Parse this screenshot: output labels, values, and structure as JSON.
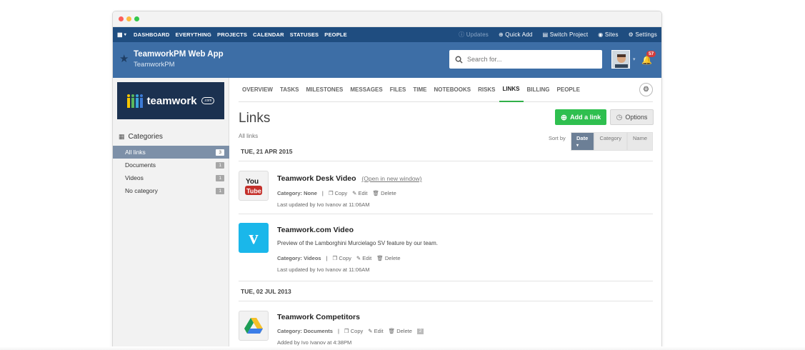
{
  "topnav": {
    "items": [
      "DASHBOARD",
      "EVERYTHING",
      "PROJECTS",
      "CALENDAR",
      "STATUSES",
      "PEOPLE"
    ],
    "updates": "Updates",
    "quick_add": "Quick Add",
    "switch_project": "Switch Project",
    "sites": "Sites",
    "settings": "Settings"
  },
  "header": {
    "title": "TeamworkPM Web App",
    "subtitle": "TeamworkPM",
    "search_placeholder": "Search for...",
    "notifications": "57"
  },
  "sidebar": {
    "brand": "teamwork",
    "brand_suffix": ".com",
    "categories_label": "Categories",
    "items": [
      {
        "label": "All links",
        "count": "3"
      },
      {
        "label": "Documents",
        "count": "1"
      },
      {
        "label": "Videos",
        "count": "1"
      },
      {
        "label": "No category",
        "count": "1"
      }
    ]
  },
  "tabs": [
    "OVERVIEW",
    "TASKS",
    "MILESTONES",
    "MESSAGES",
    "FILES",
    "TIME",
    "NOTEBOOKS",
    "RISKS",
    "LINKS",
    "BILLING",
    "PEOPLE"
  ],
  "active_tab": "LINKS",
  "main": {
    "title": "Links",
    "add_link": "Add a link",
    "options": "Options",
    "all_links": "All links",
    "sort_by": "Sort by",
    "sort": [
      "Date",
      "Category",
      "Name"
    ]
  },
  "groups": [
    {
      "date": "TUE, 21 APR 2015"
    },
    {
      "date": "TUE, 02 JUL 2013"
    }
  ],
  "links": [
    {
      "title": "Teamwork Desk Video",
      "open_link": "(Open in new window)",
      "description": "",
      "category_label": "Category:",
      "category": "None",
      "copy": "Copy",
      "edit": "Edit",
      "delete": "Delete",
      "updated": "Last updated by Ivo Ivanov at 11:06AM",
      "icon": "youtube-icon"
    },
    {
      "title": "Teamwork.com Video",
      "description": "Preview of the Lamborghini Murcielago SV feature by our team.",
      "category_label": "Category:",
      "category": "Videos",
      "copy": "Copy",
      "edit": "Edit",
      "delete": "Delete",
      "updated": "Last updated by Ivo Ivanov at 11:06AM",
      "icon": "vimeo-icon"
    },
    {
      "title": "Teamwork Competitors",
      "description": "",
      "category_label": "Category:",
      "category": "Documents",
      "copy": "Copy",
      "edit": "Edit",
      "delete": "Delete",
      "comments": "2",
      "updated": "Added by Ivo Ivanov at 4:38PM",
      "icon": "google-drive-icon"
    }
  ],
  "colors": {
    "nav": "#1f4d80",
    "header": "#3d6ea6",
    "accent": "#2fbf4f",
    "active_tab": "#31b049"
  }
}
